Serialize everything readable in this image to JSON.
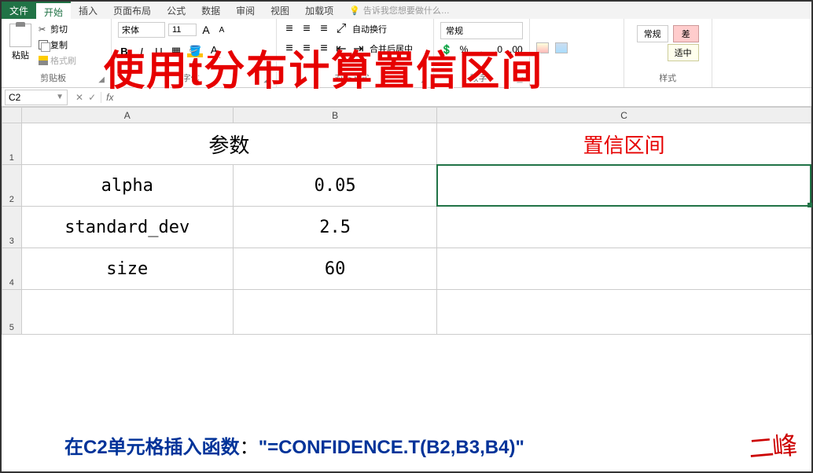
{
  "tabs": {
    "file": "文件",
    "home": "开始",
    "insert": "插入",
    "layout": "页面布局",
    "formula": "公式",
    "data": "数据",
    "review": "审阅",
    "view": "视图",
    "addins": "加载项",
    "hint": "告诉我您想要做什么…"
  },
  "ribbon": {
    "paste": "粘贴",
    "cut": "剪切",
    "copy": "复制",
    "format_painter": "格式刷",
    "clipboard_label": "剪贴板",
    "font_name": "宋体",
    "font_size": "11",
    "font_label": "字体",
    "align_label": "对齐方式",
    "wrap": "自动换行",
    "merge": "合并后居中",
    "number_format": "常规",
    "number_label": "数字",
    "style_label": "样式",
    "bad": "差",
    "moderate": "适中"
  },
  "overlay_title": "使用t分布计算置信区间",
  "namebox": "C2",
  "columns": {
    "A": "A",
    "B": "B",
    "C": "C"
  },
  "rows": [
    "1",
    "2",
    "3",
    "4",
    "5"
  ],
  "cells": {
    "A1B1": "参数",
    "C1": "置信区间",
    "A2": "alpha",
    "B2": "0.05",
    "A3": "standard_dev",
    "B3": "2.5",
    "A4": "size",
    "B4": "60"
  },
  "bottom_instruction_prefix": "在C2单元格插入函数",
  "bottom_instruction_sep": "：",
  "bottom_instruction_formula": "\"=CONFIDENCE.T(B2,B3,B4)\"",
  "signature": "二峰"
}
